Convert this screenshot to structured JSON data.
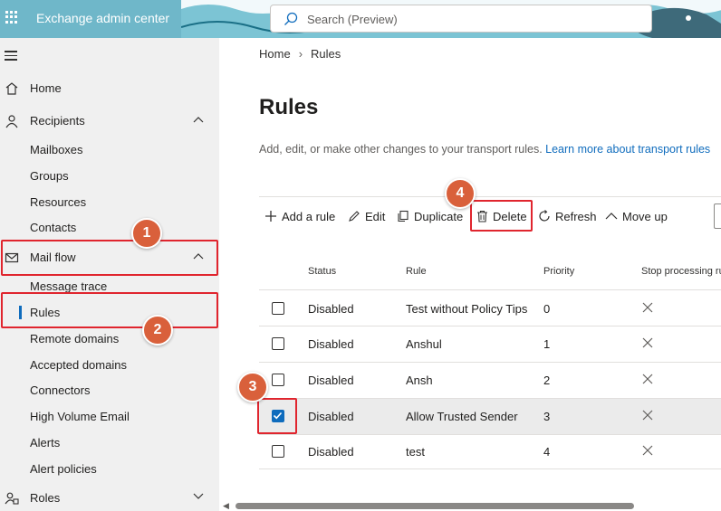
{
  "header": {
    "app_title": "Exchange admin center",
    "search_placeholder": "Search (Preview)",
    "color": "#6fb7c9"
  },
  "sidebar": {
    "items": [
      {
        "label": "Home",
        "icon": "home-icon"
      },
      {
        "label": "Recipients",
        "icon": "person-icon",
        "expanded": true
      },
      {
        "label": "Mailboxes"
      },
      {
        "label": "Groups"
      },
      {
        "label": "Resources"
      },
      {
        "label": "Contacts"
      },
      {
        "label": "Mail flow",
        "icon": "mail-icon",
        "expanded": true
      },
      {
        "label": "Message trace"
      },
      {
        "label": "Rules",
        "selected": true
      },
      {
        "label": "Remote domains"
      },
      {
        "label": "Accepted domains"
      },
      {
        "label": "Connectors"
      },
      {
        "label": "High Volume Email"
      },
      {
        "label": "Alerts"
      },
      {
        "label": "Alert policies"
      },
      {
        "label": "Roles",
        "icon": "roles-icon",
        "expanded": false
      }
    ]
  },
  "breadcrumb": {
    "home": "Home",
    "current": "Rules"
  },
  "page": {
    "title": "Rules",
    "description": "Add, edit, or make other changes to your transport rules. ",
    "learn_more": "Learn more about transport rules"
  },
  "toolbar": {
    "add": "Add a rule",
    "edit": "Edit",
    "duplicate": "Duplicate",
    "delete": "Delete",
    "refresh": "Refresh",
    "move_up": "Move up"
  },
  "table": {
    "columns": [
      "Status",
      "Rule",
      "Priority",
      "Stop processing ru"
    ],
    "rows": [
      {
        "status": "Disabled",
        "rule": "Test without Policy Tips",
        "priority": "0",
        "checked": false
      },
      {
        "status": "Disabled",
        "rule": "Anshul",
        "priority": "1",
        "checked": false
      },
      {
        "status": "Disabled",
        "rule": "Ansh",
        "priority": "2",
        "checked": false
      },
      {
        "status": "Disabled",
        "rule": "Allow Trusted Sender",
        "priority": "3",
        "checked": true
      },
      {
        "status": "Disabled",
        "rule": "test",
        "priority": "4",
        "checked": false
      }
    ]
  },
  "annotations": {
    "step1": "1",
    "step2": "2",
    "step3": "3",
    "step4": "4",
    "highlight_color": "#e0252e",
    "badge_color": "#d9603b"
  }
}
